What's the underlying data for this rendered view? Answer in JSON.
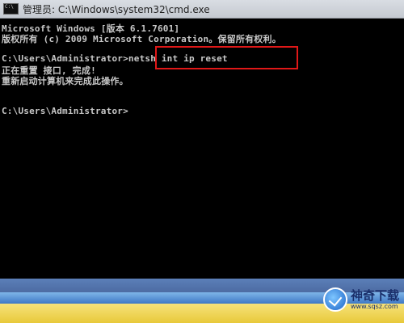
{
  "window": {
    "icon_label": "C:\\",
    "title": "管理员: C:\\Windows\\system32\\cmd.exe"
  },
  "console": {
    "lines": [
      "Microsoft Windows [版本 6.1.7601]",
      "版权所有 (c) 2009 Microsoft Corporation。保留所有权利。",
      "",
      "C:\\Users\\Administrator>netsh int ip reset",
      "正在重置 接口, 完成!",
      "重新启动计算机来完成此操作。",
      "",
      "",
      "C:\\Users\\Administrator>"
    ],
    "highlighted_command": "netsh int ip reset",
    "highlight_color": "#e01818"
  },
  "watermark": {
    "title": "神奇下载",
    "url": "www.sqsz.com"
  }
}
